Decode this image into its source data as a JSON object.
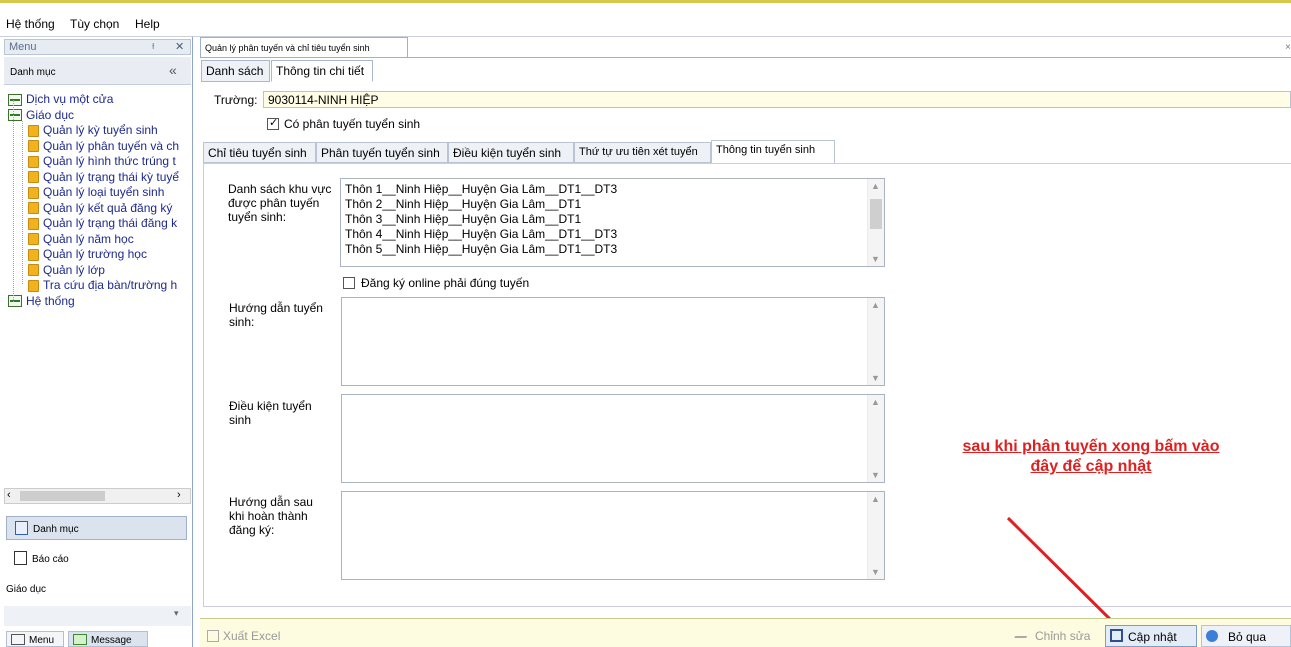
{
  "menubar": {
    "items": [
      "Hệ thống",
      "Tùy chọn",
      "Help"
    ]
  },
  "left_panel": {
    "title": "Menu",
    "pin": "ᵻ",
    "close": "✕",
    "section_title": "Danh mục",
    "collapse": "«",
    "tree": [
      {
        "label": "Dịch vụ một cửa",
        "icon": "grid-icon",
        "level": 0
      },
      {
        "label": "Giáo dục",
        "icon": "grid-icon",
        "level": 0
      },
      {
        "label": "Quản lý kỳ tuyển sinh",
        "icon": "folder-icon",
        "level": 1
      },
      {
        "label": "Quản lý phân tuyến và ch",
        "icon": "folder-icon",
        "level": 1
      },
      {
        "label": "Quản lý hình thức trúng t",
        "icon": "folder-icon",
        "level": 1
      },
      {
        "label": "Quản lý trạng thái kỳ tuyể",
        "icon": "folder-icon",
        "level": 1
      },
      {
        "label": "Quản lý loại tuyển sinh",
        "icon": "folder-icon",
        "level": 1
      },
      {
        "label": "Quản lý kết quả đăng ký",
        "icon": "folder-icon",
        "level": 1
      },
      {
        "label": "Quản lý trạng thái đăng k",
        "icon": "folder-icon",
        "level": 1
      },
      {
        "label": "Quản lý năm học",
        "icon": "folder-icon",
        "level": 1
      },
      {
        "label": "Quản lý trường học",
        "icon": "folder-icon",
        "level": 1
      },
      {
        "label": "Quản lý lớp",
        "icon": "folder-icon",
        "level": 1
      },
      {
        "label": "Tra cứu địa bàn/trường h",
        "icon": "folder-icon",
        "level": 1
      },
      {
        "label": "Hệ thống",
        "icon": "grid-icon",
        "level": 0
      }
    ],
    "nav": {
      "danh_muc": "Danh mục",
      "bao_cao": "Báo cáo",
      "group_label": "Giáo dục"
    },
    "bottom_tabs": {
      "menu": "Menu",
      "message": "Message"
    }
  },
  "doc_tab": {
    "title": "Quản lý phân tuyến và chỉ tiêu tuyển sinh",
    "close": "×"
  },
  "subtabs": {
    "list": "Danh sách",
    "detail": "Thông tin chi tiết"
  },
  "form": {
    "truong_label": "Trường:",
    "truong_value": "9030114-NINH HIỆP",
    "co_phan_tuyen": "Có phân tuyến tuyển sinh",
    "co_phan_tuyen_checked": true
  },
  "inner_tabs": [
    "Chỉ tiêu tuyển sinh",
    "Phân tuyến tuyển sinh",
    "Điều kiện tuyển sinh",
    "Thứ tự ưu tiên xét tuyển",
    "Thông tin tuyển sinh"
  ],
  "active_inner_tab": "Thông tin tuyển sinh",
  "info": {
    "khu_vuc_label": "Danh sách khu vực được phân tuyến tuyển sinh:",
    "khu_vuc_items": [
      "Thôn 1__Ninh Hiệp__Huyện Gia Lâm__DT1__DT3",
      "Thôn 2__Ninh Hiệp__Huyện Gia Lâm__DT1",
      "Thôn 3__Ninh Hiệp__Huyện Gia Lâm__DT1",
      "Thôn 4__Ninh Hiệp__Huyện Gia Lâm__DT1__DT3",
      "Thôn 5__Ninh Hiệp__Huyện Gia Lâm__DT1__DT3"
    ],
    "dang_ky_online": "Đăng ký online phải đúng tuyến",
    "dang_ky_online_checked": false,
    "huong_dan_label": "Hướng dẫn tuyển sinh:",
    "dieu_kien_label": "Điều kiện tuyển sinh",
    "huong_dan_sau_label": "Hướng dẫn sau khi hoàn thành đăng ký:"
  },
  "annotation": {
    "line1": "sau khi phân tuyến xong bấm vào",
    "line2": "đây để cập nhật",
    "color": "#e02020"
  },
  "bottom": {
    "xuat_excel": "Xuất Excel",
    "chinh_sua": "Chỉnh sửa",
    "cap_nhat": "Cập nhật",
    "bo_qua": "Bỏ qua"
  }
}
